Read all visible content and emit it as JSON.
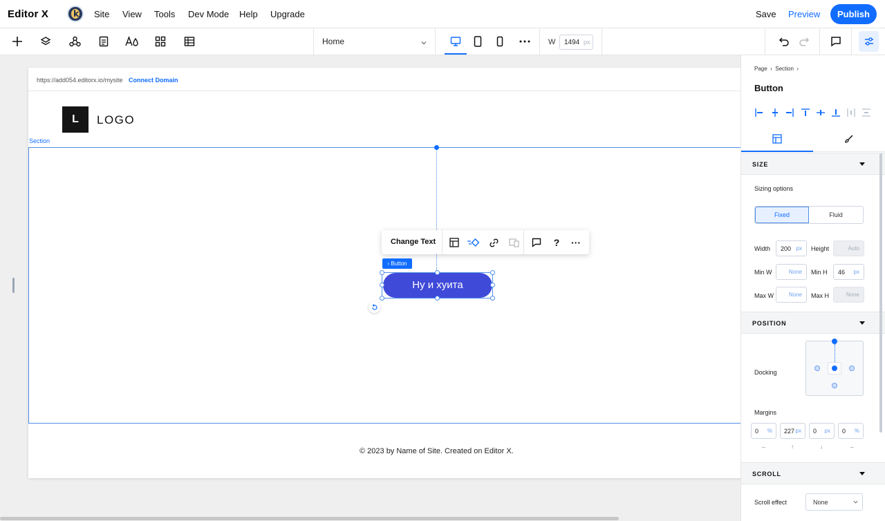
{
  "app": {
    "brand": "Editor X",
    "menu": [
      "Site",
      "View",
      "Tools",
      "Dev Mode",
      "Help",
      "Upgrade"
    ],
    "save": "Save",
    "preview": "Preview",
    "publish": "Publish"
  },
  "toolbar": {
    "page": "Home",
    "width_label": "W",
    "width_value": "1494",
    "width_unit": "px"
  },
  "site": {
    "url": "https://add054.editorx.io/mysite",
    "connect_domain": "Connect Domain",
    "logo_mark": "L",
    "logo_text": "LOGO",
    "section_label": "Section",
    "footer": "© 2023 by Name of Site. Created on Editor X."
  },
  "context_toolbar": {
    "change_text": "Change Text",
    "help": "?",
    "more": "···"
  },
  "selected": {
    "tag": "‹ Button",
    "button_text": "Ну и хуита"
  },
  "inspector": {
    "breadcrumb": [
      "Page",
      "Section"
    ],
    "title": "Button",
    "size": {
      "header": "SIZE",
      "sizing_options": "Sizing options",
      "fixed": "Fixed",
      "fluid": "Fluid",
      "width_label": "Width",
      "width_value": "200",
      "width_unit": "px",
      "height_label": "Height",
      "height_value": "Auto",
      "min_w_label": "Min W",
      "min_w_value": "None",
      "min_h_label": "Min H",
      "min_h_value": "46",
      "min_h_unit": "px",
      "max_w_label": "Max W",
      "max_w_value": "None",
      "max_h_label": "Max H",
      "max_h_value": "None"
    },
    "position": {
      "header": "POSITION",
      "docking": "Docking",
      "margins": "Margins",
      "margin_values": [
        {
          "v": "0",
          "u": "%"
        },
        {
          "v": "227",
          "u": "px"
        },
        {
          "v": "0",
          "u": "px"
        },
        {
          "v": "0",
          "u": "%"
        }
      ]
    },
    "scroll": {
      "header": "SCROLL",
      "effect_label": "Scroll effect",
      "effect_value": "None"
    }
  },
  "colors": {
    "accent": "#116dff",
    "button": "#3f4ad9"
  }
}
